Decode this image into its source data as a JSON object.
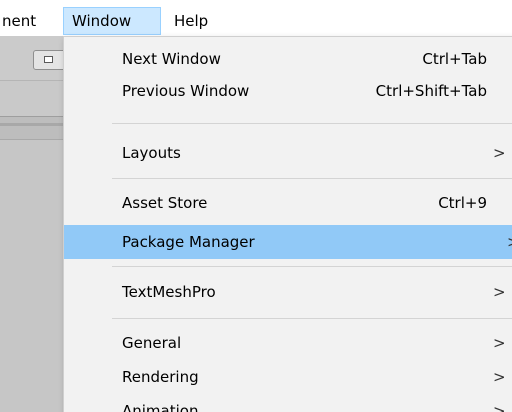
{
  "menubar": {
    "items": [
      {
        "label": "nent"
      },
      {
        "label": "Window"
      },
      {
        "label": "Help"
      }
    ]
  },
  "window_menu": {
    "items": [
      {
        "label": "Next Window",
        "shortcut": "Ctrl+Tab"
      },
      {
        "label": "Previous Window",
        "shortcut": "Ctrl+Shift+Tab"
      },
      {
        "label": "Layouts",
        "submenu_arrow": ">"
      },
      {
        "label": "Asset Store",
        "shortcut": "Ctrl+9"
      },
      {
        "label": "Package Manager",
        "submenu_arrow": ">"
      },
      {
        "label": "TextMeshPro",
        "submenu_arrow": ">"
      },
      {
        "label": "General",
        "submenu_arrow": ">"
      },
      {
        "label": "Rendering",
        "submenu_arrow": ">"
      },
      {
        "label": "Animation",
        "submenu_arrow": ">"
      }
    ],
    "highlighted_item": "Package Manager"
  },
  "colors": {
    "menu_highlight": "#91c9f7",
    "menubar_active": "#cce8ff",
    "menu_background": "#f2f2f2",
    "editor_background": "#c9c9c9"
  }
}
